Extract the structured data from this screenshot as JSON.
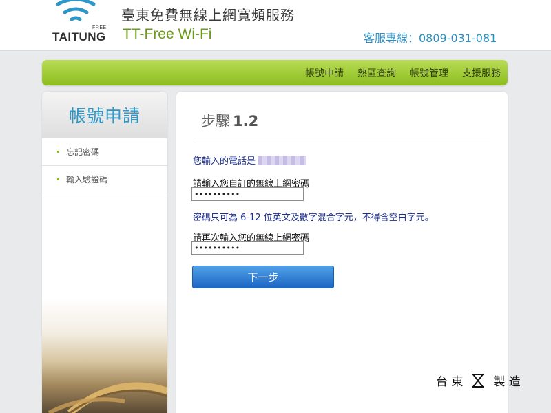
{
  "header": {
    "logo_small": "FREE",
    "logo_main": "TAITUNG",
    "title": "臺東免費無線上網寬頻服務",
    "subtitle": "TT-Free Wi-Fi",
    "hotline": "客服專線：0809-031-081"
  },
  "nav": {
    "items": [
      "帳號申請",
      "熱區查詢",
      "帳號管理",
      "支援服務"
    ]
  },
  "sidebar": {
    "title": "帳號申請",
    "items": [
      "忘記密碼",
      "輸入驗證碼"
    ]
  },
  "content": {
    "step_label": "步驟",
    "step_number": "1.2",
    "phone_prefix": "您輸入的電話是",
    "password_label": "請輸入您自訂的無線上網密碼",
    "password_value": "••••••••••",
    "hint": "密碼只可為 6-12 位英文及數字混合字元，不得含空白字元。",
    "confirm_label": "請再次輸入您的無線上網密碼",
    "confirm_value": "••••••••••",
    "next_button": "下一步"
  },
  "footer": {
    "brand_left": "台 東",
    "brand_right": "製 造"
  },
  "colors": {
    "nav_green": "#9cc92e",
    "accent_blue": "#2d97c7",
    "button_blue": "#1c66c4",
    "link_navy": "#1d2f90"
  }
}
